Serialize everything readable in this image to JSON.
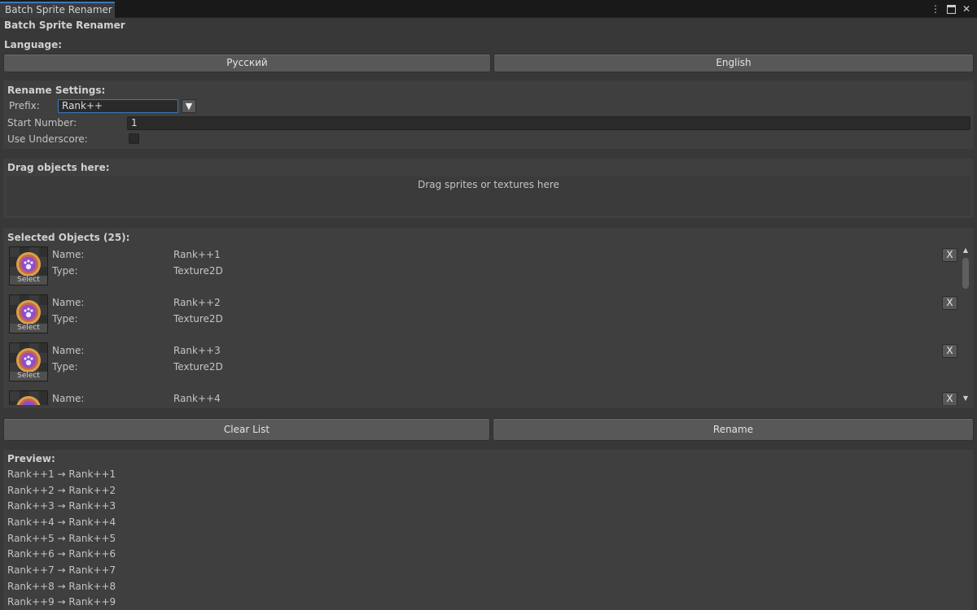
{
  "window": {
    "tab_title": "Batch Sprite Renamer",
    "heading": "Batch Sprite Renamer"
  },
  "language": {
    "label": "Language:",
    "russian": "Русский",
    "english": "English"
  },
  "settings": {
    "title": "Rename Settings:",
    "prefix_label": "Prefix:",
    "prefix_value": "Rank++",
    "start_label": "Start Number:",
    "start_value": "1",
    "underscore_label": "Use Underscore:",
    "underscore_checked": false
  },
  "drag": {
    "title": "Drag objects here:",
    "hint": "Drag sprites or textures here"
  },
  "selected": {
    "title": "Selected Objects (25):",
    "name_label": "Name:",
    "type_label": "Type:",
    "select_label": "Select",
    "remove_label": "X",
    "items": [
      {
        "name": "Rank++1",
        "type": "Texture2D"
      },
      {
        "name": "Rank++2",
        "type": "Texture2D"
      },
      {
        "name": "Rank++3",
        "type": "Texture2D"
      },
      {
        "name": "Rank++4",
        "type": ""
      }
    ]
  },
  "actions": {
    "clear": "Clear List",
    "rename": "Rename"
  },
  "preview": {
    "title": "Preview:",
    "lines": [
      "Rank++1 → Rank++1",
      "Rank++2 → Rank++2",
      "Rank++3 → Rank++3",
      "Rank++4 → Rank++4",
      "Rank++5 → Rank++5",
      "Rank++6 → Rank++6",
      "Rank++7 → Rank++7",
      "Rank++8 → Rank++8",
      "Rank++9 → Rank++9"
    ]
  },
  "icons": {
    "menu": "kebab-menu-icon",
    "maximize": "maximize-icon",
    "close": "close-icon",
    "dropdown": "dropdown-arrow-icon",
    "thumbnail": "paw-badge-icon"
  },
  "colors": {
    "accent": "#3a79bb",
    "background": "#383838",
    "button": "#585858",
    "badge_purple": "#8a4fc9",
    "badge_gold": "#d9a24a"
  }
}
